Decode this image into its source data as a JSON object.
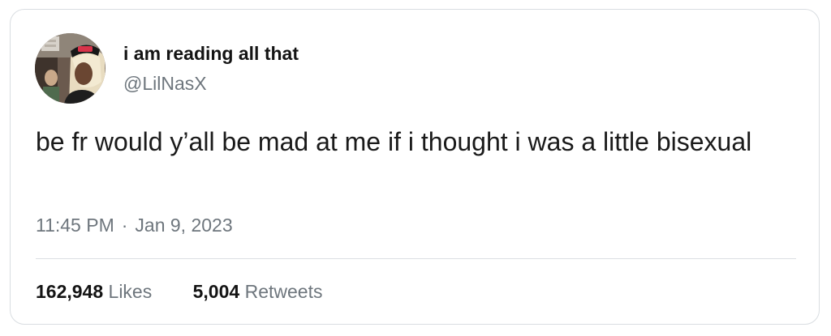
{
  "tweet": {
    "author": {
      "display_name": "i am reading all that",
      "handle": "@LilNasX",
      "avatar_icon": "profile-photo"
    },
    "text": "be fr would y’all be mad at me if i thought i was a little bisexual",
    "time": "11:45 PM",
    "separator": "·",
    "date": "Jan 9, 2023",
    "stats": {
      "likes_count": "162,948",
      "likes_label": "Likes",
      "retweets_count": "5,004",
      "retweets_label": "Retweets"
    }
  },
  "colors": {
    "secondary_text": "#6e767d",
    "border": "#d9dde1"
  }
}
